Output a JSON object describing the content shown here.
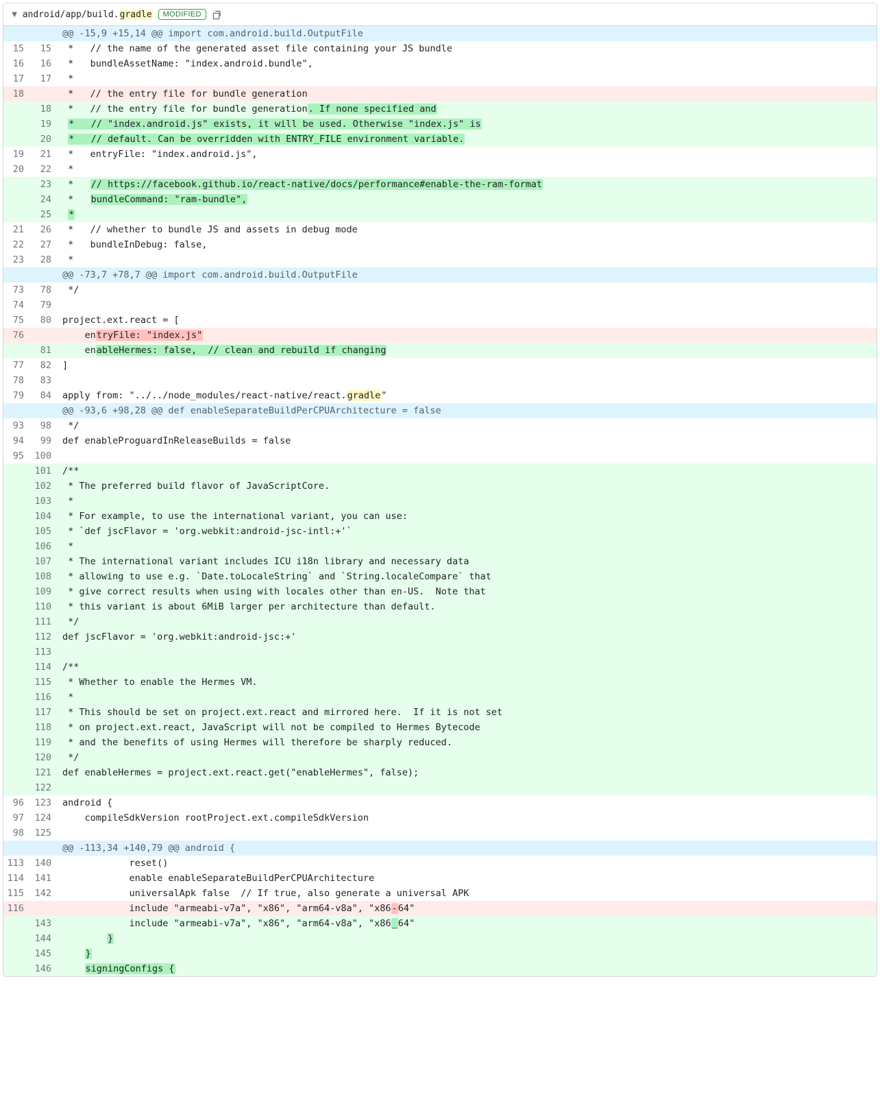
{
  "file": {
    "path_prefix": "android/app/build.",
    "path_highlight": "gradle",
    "badge": "MODIFIED"
  },
  "rows": [
    {
      "t": "hunk",
      "text": "@@ -15,9 +15,14 @@ import com.android.build.OutputFile"
    },
    {
      "t": "ctx",
      "o": "15",
      "n": "15",
      "segs": [
        {
          "x": " *   // the name of the generated asset file containing your JS bundle"
        }
      ]
    },
    {
      "t": "ctx",
      "o": "16",
      "n": "16",
      "segs": [
        {
          "x": " *   bundleAssetName: \"index.android.bundle\","
        }
      ]
    },
    {
      "t": "ctx",
      "o": "17",
      "n": "17",
      "segs": [
        {
          "x": " *"
        }
      ]
    },
    {
      "t": "del",
      "o": "18",
      "n": "",
      "segs": [
        {
          "x": " *   // the entry file for bundle generation"
        }
      ]
    },
    {
      "t": "add",
      "o": "",
      "n": "18",
      "segs": [
        {
          "x": " *   // the entry file for bundle generation"
        },
        {
          "x": ". If none specified and",
          "k": "add"
        }
      ]
    },
    {
      "t": "add",
      "o": "",
      "n": "19",
      "segs": [
        {
          "x": " "
        },
        {
          "x": "*   // \"index.android.js\" exists, it will be used. Otherwise \"index.js\" is",
          "k": "add"
        }
      ]
    },
    {
      "t": "add",
      "o": "",
      "n": "20",
      "segs": [
        {
          "x": " "
        },
        {
          "x": "*   // default. Can be overridden with ENTRY_FILE environment variable.",
          "k": "add"
        }
      ]
    },
    {
      "t": "ctx",
      "o": "19",
      "n": "21",
      "segs": [
        {
          "x": " *   entryFile: \"index.android.js\","
        }
      ]
    },
    {
      "t": "ctx",
      "o": "20",
      "n": "22",
      "segs": [
        {
          "x": " *"
        }
      ]
    },
    {
      "t": "add",
      "o": "",
      "n": "23",
      "segs": [
        {
          "x": " *   "
        },
        {
          "x": "// https://facebook.github.io/react-native/docs/performance#enable-the-ram-format",
          "k": "add"
        }
      ]
    },
    {
      "t": "add",
      "o": "",
      "n": "24",
      "segs": [
        {
          "x": " *   "
        },
        {
          "x": "bundleCommand: \"ram-bundle\",",
          "k": "add"
        }
      ]
    },
    {
      "t": "add",
      "o": "",
      "n": "25",
      "segs": [
        {
          "x": " "
        },
        {
          "x": "*",
          "k": "add"
        }
      ]
    },
    {
      "t": "ctx",
      "o": "21",
      "n": "26",
      "segs": [
        {
          "x": " *   // whether to bundle JS and assets in debug mode"
        }
      ]
    },
    {
      "t": "ctx",
      "o": "22",
      "n": "27",
      "segs": [
        {
          "x": " *   bundleInDebug: false,"
        }
      ]
    },
    {
      "t": "ctx",
      "o": "23",
      "n": "28",
      "segs": [
        {
          "x": " *"
        }
      ]
    },
    {
      "t": "hunk",
      "text": "@@ -73,7 +78,7 @@ import com.android.build.OutputFile"
    },
    {
      "t": "ctx",
      "o": "73",
      "n": "78",
      "segs": [
        {
          "x": " */"
        }
      ]
    },
    {
      "t": "ctx",
      "o": "74",
      "n": "79",
      "segs": [
        {
          "x": ""
        }
      ]
    },
    {
      "t": "ctx",
      "o": "75",
      "n": "80",
      "segs": [
        {
          "x": "project.ext.react = ["
        }
      ]
    },
    {
      "t": "del",
      "o": "76",
      "n": "",
      "segs": [
        {
          "x": "    en"
        },
        {
          "x": "tryFile: \"index.js\"",
          "k": "del"
        }
      ]
    },
    {
      "t": "add",
      "o": "",
      "n": "81",
      "segs": [
        {
          "x": "    en"
        },
        {
          "x": "ableHermes: false,  // clean and rebuild if changing",
          "k": "add"
        }
      ]
    },
    {
      "t": "ctx",
      "o": "77",
      "n": "82",
      "segs": [
        {
          "x": "]"
        }
      ]
    },
    {
      "t": "ctx",
      "o": "78",
      "n": "83",
      "segs": [
        {
          "x": ""
        }
      ]
    },
    {
      "t": "ctx",
      "o": "79",
      "n": "84",
      "segs": [
        {
          "x": "apply from: \"../../node_modules/react-native/react."
        },
        {
          "x": "gradle",
          "k": "hl"
        },
        {
          "x": "\""
        }
      ]
    },
    {
      "t": "hunk",
      "text": "@@ -93,6 +98,28 @@ def enableSeparateBuildPerCPUArchitecture = false"
    },
    {
      "t": "ctx",
      "o": "93",
      "n": "98",
      "segs": [
        {
          "x": " */"
        }
      ]
    },
    {
      "t": "ctx",
      "o": "94",
      "n": "99",
      "segs": [
        {
          "x": "def enableProguardInReleaseBuilds = false"
        }
      ]
    },
    {
      "t": "ctx",
      "o": "95",
      "n": "100",
      "segs": [
        {
          "x": ""
        }
      ]
    },
    {
      "t": "add",
      "o": "",
      "n": "101",
      "segs": [
        {
          "x": "/**"
        }
      ]
    },
    {
      "t": "add",
      "o": "",
      "n": "102",
      "segs": [
        {
          "x": " * The preferred build flavor of JavaScriptCore."
        }
      ]
    },
    {
      "t": "add",
      "o": "",
      "n": "103",
      "segs": [
        {
          "x": " *"
        }
      ]
    },
    {
      "t": "add",
      "o": "",
      "n": "104",
      "segs": [
        {
          "x": " * For example, to use the international variant, you can use:"
        }
      ]
    },
    {
      "t": "add",
      "o": "",
      "n": "105",
      "segs": [
        {
          "x": " * `def jscFlavor = 'org.webkit:android-jsc-intl:+'`"
        }
      ]
    },
    {
      "t": "add",
      "o": "",
      "n": "106",
      "segs": [
        {
          "x": " *"
        }
      ]
    },
    {
      "t": "add",
      "o": "",
      "n": "107",
      "segs": [
        {
          "x": " * The international variant includes ICU i18n library and necessary data"
        }
      ]
    },
    {
      "t": "add",
      "o": "",
      "n": "108",
      "segs": [
        {
          "x": " * allowing to use e.g. `Date.toLocaleString` and `String.localeCompare` that"
        }
      ]
    },
    {
      "t": "add",
      "o": "",
      "n": "109",
      "segs": [
        {
          "x": " * give correct results when using with locales other than en-US.  Note that"
        }
      ]
    },
    {
      "t": "add",
      "o": "",
      "n": "110",
      "segs": [
        {
          "x": " * this variant is about 6MiB larger per architecture than default."
        }
      ]
    },
    {
      "t": "add",
      "o": "",
      "n": "111",
      "segs": [
        {
          "x": " */"
        }
      ]
    },
    {
      "t": "add",
      "o": "",
      "n": "112",
      "segs": [
        {
          "x": "def jscFlavor = 'org.webkit:android-jsc:+'"
        }
      ]
    },
    {
      "t": "add",
      "o": "",
      "n": "113",
      "segs": [
        {
          "x": ""
        }
      ]
    },
    {
      "t": "add",
      "o": "",
      "n": "114",
      "segs": [
        {
          "x": "/**"
        }
      ]
    },
    {
      "t": "add",
      "o": "",
      "n": "115",
      "segs": [
        {
          "x": " * Whether to enable the Hermes VM."
        }
      ]
    },
    {
      "t": "add",
      "o": "",
      "n": "116",
      "segs": [
        {
          "x": " *"
        }
      ]
    },
    {
      "t": "add",
      "o": "",
      "n": "117",
      "segs": [
        {
          "x": " * This should be set on project.ext.react and mirrored here.  If it is not set"
        }
      ]
    },
    {
      "t": "add",
      "o": "",
      "n": "118",
      "segs": [
        {
          "x": " * on project.ext.react, JavaScript will not be compiled to Hermes Bytecode"
        }
      ]
    },
    {
      "t": "add",
      "o": "",
      "n": "119",
      "segs": [
        {
          "x": " * and the benefits of using Hermes will therefore be sharply reduced."
        }
      ]
    },
    {
      "t": "add",
      "o": "",
      "n": "120",
      "segs": [
        {
          "x": " */"
        }
      ]
    },
    {
      "t": "add",
      "o": "",
      "n": "121",
      "segs": [
        {
          "x": "def enableHermes = project.ext.react.get(\"enableHermes\", false);"
        }
      ]
    },
    {
      "t": "add",
      "o": "",
      "n": "122",
      "segs": [
        {
          "x": ""
        }
      ]
    },
    {
      "t": "ctx",
      "o": "96",
      "n": "123",
      "segs": [
        {
          "x": "android {"
        }
      ]
    },
    {
      "t": "ctx",
      "o": "97",
      "n": "124",
      "segs": [
        {
          "x": "    compileSdkVersion rootProject.ext.compileSdkVersion"
        }
      ]
    },
    {
      "t": "ctx",
      "o": "98",
      "n": "125",
      "segs": [
        {
          "x": ""
        }
      ]
    },
    {
      "t": "hunk",
      "text": "@@ -113,34 +140,79 @@ android {"
    },
    {
      "t": "ctx",
      "o": "113",
      "n": "140",
      "segs": [
        {
          "x": "            reset()"
        }
      ]
    },
    {
      "t": "ctx",
      "o": "114",
      "n": "141",
      "segs": [
        {
          "x": "            enable enableSeparateBuildPerCPUArchitecture"
        }
      ]
    },
    {
      "t": "ctx",
      "o": "115",
      "n": "142",
      "segs": [
        {
          "x": "            universalApk false  // If true, also generate a universal APK"
        }
      ]
    },
    {
      "t": "del",
      "o": "116",
      "n": "",
      "segs": [
        {
          "x": "            include \"armeabi-v7a\", \"x86\", \"arm64-v8a\", \"x86"
        },
        {
          "x": "-",
          "k": "del"
        },
        {
          "x": "64\""
        }
      ]
    },
    {
      "t": "add",
      "o": "",
      "n": "143",
      "segs": [
        {
          "x": "            include \"armeabi-v7a\", \"x86\", \"arm64-v8a\", \"x86"
        },
        {
          "x": "_",
          "k": "add"
        },
        {
          "x": "64\""
        }
      ]
    },
    {
      "t": "add",
      "o": "",
      "n": "144",
      "segs": [
        {
          "x": "        "
        },
        {
          "x": "}",
          "k": "add"
        }
      ]
    },
    {
      "t": "add",
      "o": "",
      "n": "145",
      "segs": [
        {
          "x": "    "
        },
        {
          "x": "}",
          "k": "add"
        }
      ]
    },
    {
      "t": "add",
      "o": "",
      "n": "146",
      "segs": [
        {
          "x": "    "
        },
        {
          "x": "signingConfigs {",
          "k": "add"
        }
      ]
    }
  ]
}
